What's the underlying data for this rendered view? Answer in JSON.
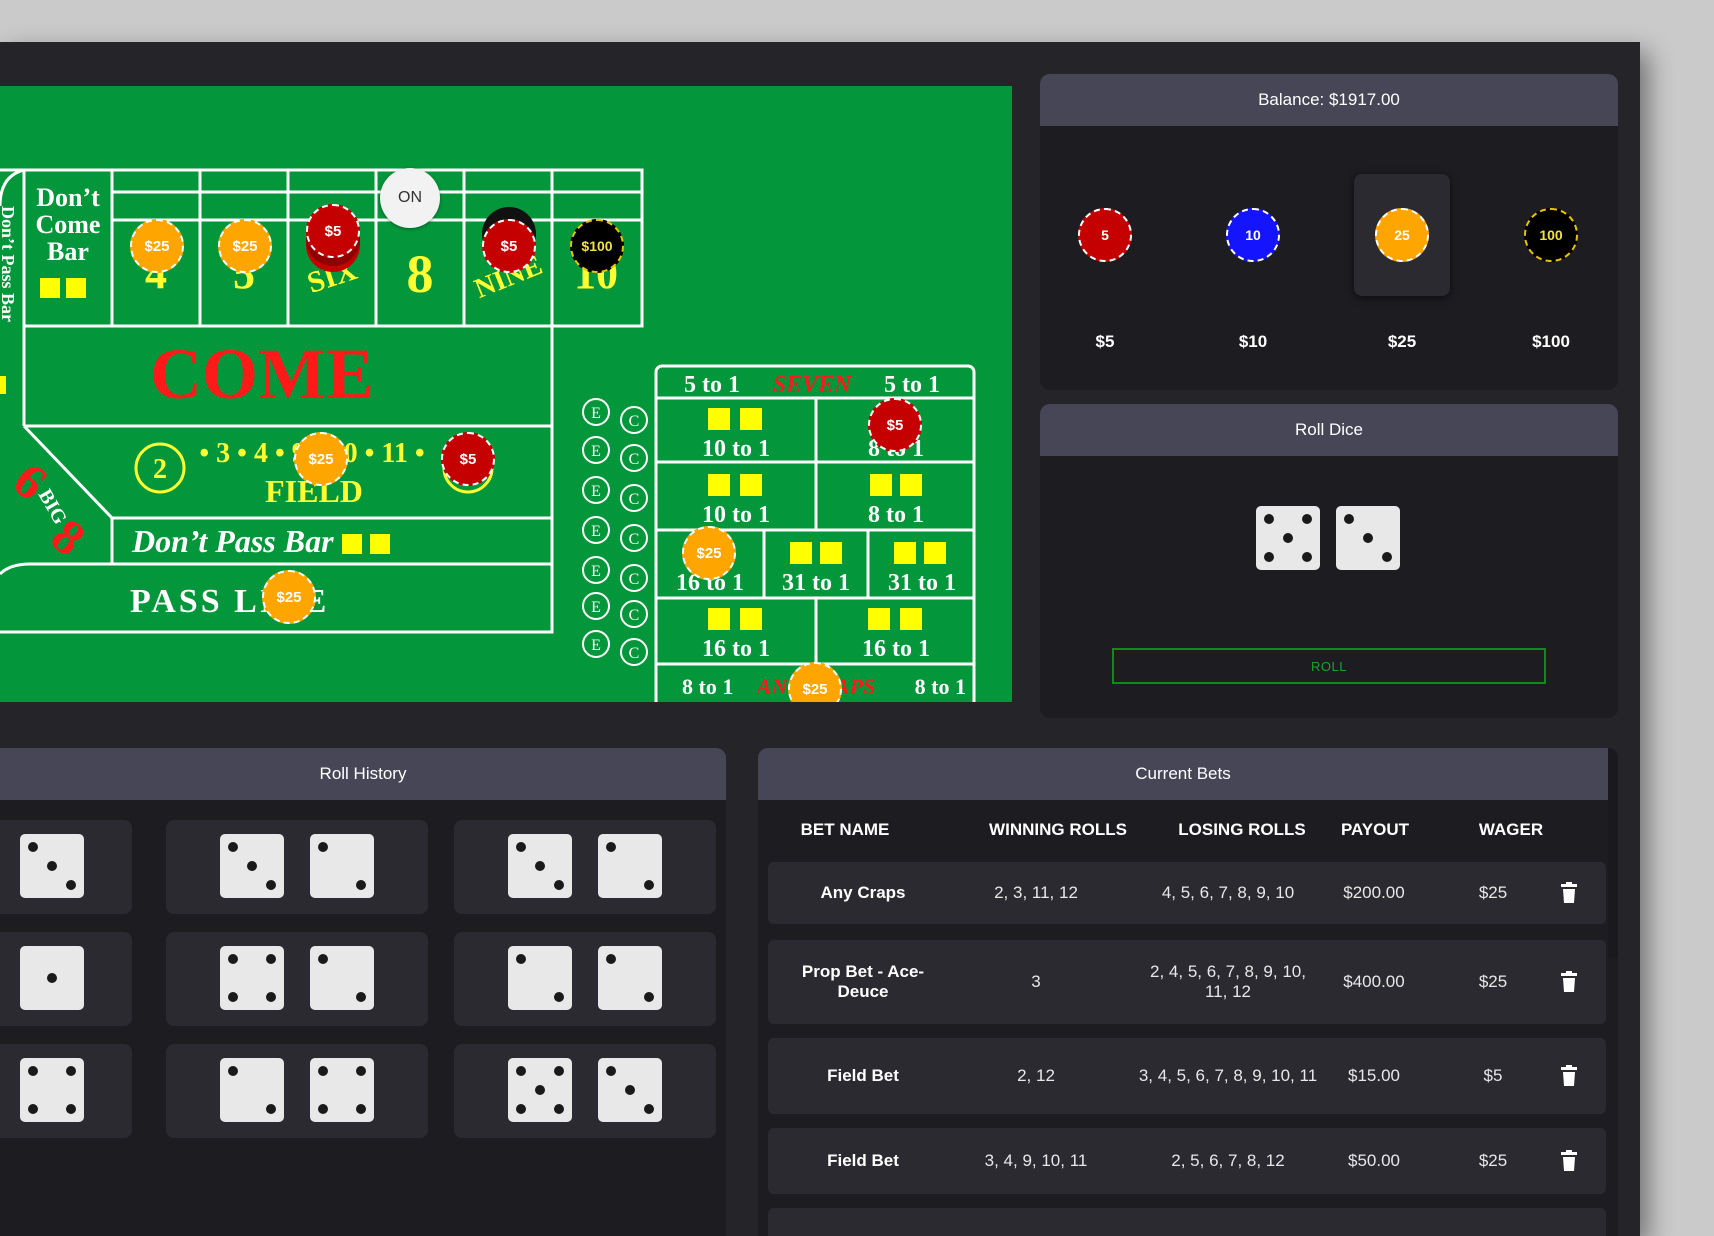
{
  "balance": {
    "label": "Balance: $1917.00"
  },
  "chip_selector": {
    "chips": [
      {
        "value": "5",
        "label": "$5",
        "color": "#c40000"
      },
      {
        "value": "10",
        "label": "$10",
        "color": "#1414ff"
      },
      {
        "value": "25",
        "label": "$25",
        "color": "#ffa500",
        "selected": true
      },
      {
        "value": "100",
        "label": "$100",
        "color": "#000000"
      }
    ]
  },
  "roll_dice": {
    "title": "Roll Dice",
    "button_label": "ROLL",
    "current": [
      5,
      3
    ]
  },
  "table": {
    "on_marker": "ON",
    "dont_come_bar": [
      "Don’t",
      "Come",
      "Bar"
    ],
    "place_numbers": [
      "4",
      "5",
      "SIX",
      "8",
      "NINE",
      "10"
    ],
    "come_label": "COME",
    "field_label": "FIELD",
    "field_numbers": "• 3 • 4 • 9 • 10 • 11 •",
    "field_two": "2",
    "field_twelve": "12",
    "dont_pass_label": "Don’t Pass Bar",
    "pass_line_label": "PASS LINE",
    "big68": "BIG",
    "big_six": "6",
    "big_eight": "8",
    "left_edge_text": "Don’t Pass Bar",
    "props": {
      "seven_left": "5 to 1",
      "seven_label": "SEVEN",
      "seven_right": "5 to 1",
      "hard6": "10 to 1",
      "hard10": "8 to 1",
      "hard8": "10 to 1",
      "hard4": "8 to 1",
      "ace_deuce": "16 to 1",
      "aces": "31 to 1",
      "twelve": "31 to 1",
      "yo_left": "16 to 1",
      "yo_right": "16 to 1",
      "any_left": "8 to 1",
      "any_label": "ANY CRAPS",
      "any_right": "8 to 1",
      "e": "E",
      "c": "C"
    },
    "placed_chips": [
      {
        "label": "$25",
        "color": "#ffa500",
        "spot": "place-4"
      },
      {
        "label": "$25",
        "color": "#ffa500",
        "spot": "place-5"
      },
      {
        "label": "$5",
        "color": "#c40000",
        "spot": "place-6"
      },
      {
        "label": "$5",
        "color": "#c40000",
        "spot": "place-9"
      },
      {
        "label": "$100",
        "color": "#000000",
        "spot": "place-10"
      },
      {
        "label": "$25",
        "color": "#ffa500",
        "spot": "field"
      },
      {
        "label": "$5",
        "color": "#c40000",
        "spot": "field-12"
      },
      {
        "label": "$25",
        "color": "#ffa500",
        "spot": "pass-line"
      },
      {
        "label": "$5",
        "color": "#c40000",
        "spot": "hard-10"
      },
      {
        "label": "$25",
        "color": "#ffa500",
        "spot": "ace-deuce"
      },
      {
        "label": "$25",
        "color": "#ffa500",
        "spot": "any-craps"
      }
    ]
  },
  "roll_history": {
    "title": "Roll History",
    "rolls": [
      [
        3
      ],
      [
        3,
        2
      ],
      [
        3,
        2
      ],
      [
        1
      ],
      [
        4,
        2
      ],
      [
        2,
        2
      ],
      [
        4
      ],
      [
        2,
        4
      ],
      [
        5,
        3
      ]
    ]
  },
  "current_bets": {
    "title": "Current Bets",
    "headers": [
      "BET NAME",
      "WINNING ROLLS",
      "LOSING ROLLS",
      "PAYOUT",
      "WAGER"
    ],
    "rows": [
      {
        "name": "Any Craps",
        "win": "2, 3, 11, 12",
        "lose": "4, 5, 6, 7, 8, 9, 10",
        "payout": "$200.00",
        "wager": "$25"
      },
      {
        "name": "Prop Bet - Ace-Deuce",
        "win": "3",
        "lose": "2, 4, 5, 6, 7, 8, 9, 10, 11, 12",
        "payout": "$400.00",
        "wager": "$25"
      },
      {
        "name": "Field Bet",
        "win": "2, 12",
        "lose": "3, 4, 5, 6, 7, 8, 9, 10, 11",
        "payout": "$15.00",
        "wager": "$5"
      },
      {
        "name": "Field Bet",
        "win": "3, 4, 9, 10, 11",
        "lose": "2, 5, 6, 7, 8, 12",
        "payout": "$50.00",
        "wager": "$25"
      }
    ]
  }
}
